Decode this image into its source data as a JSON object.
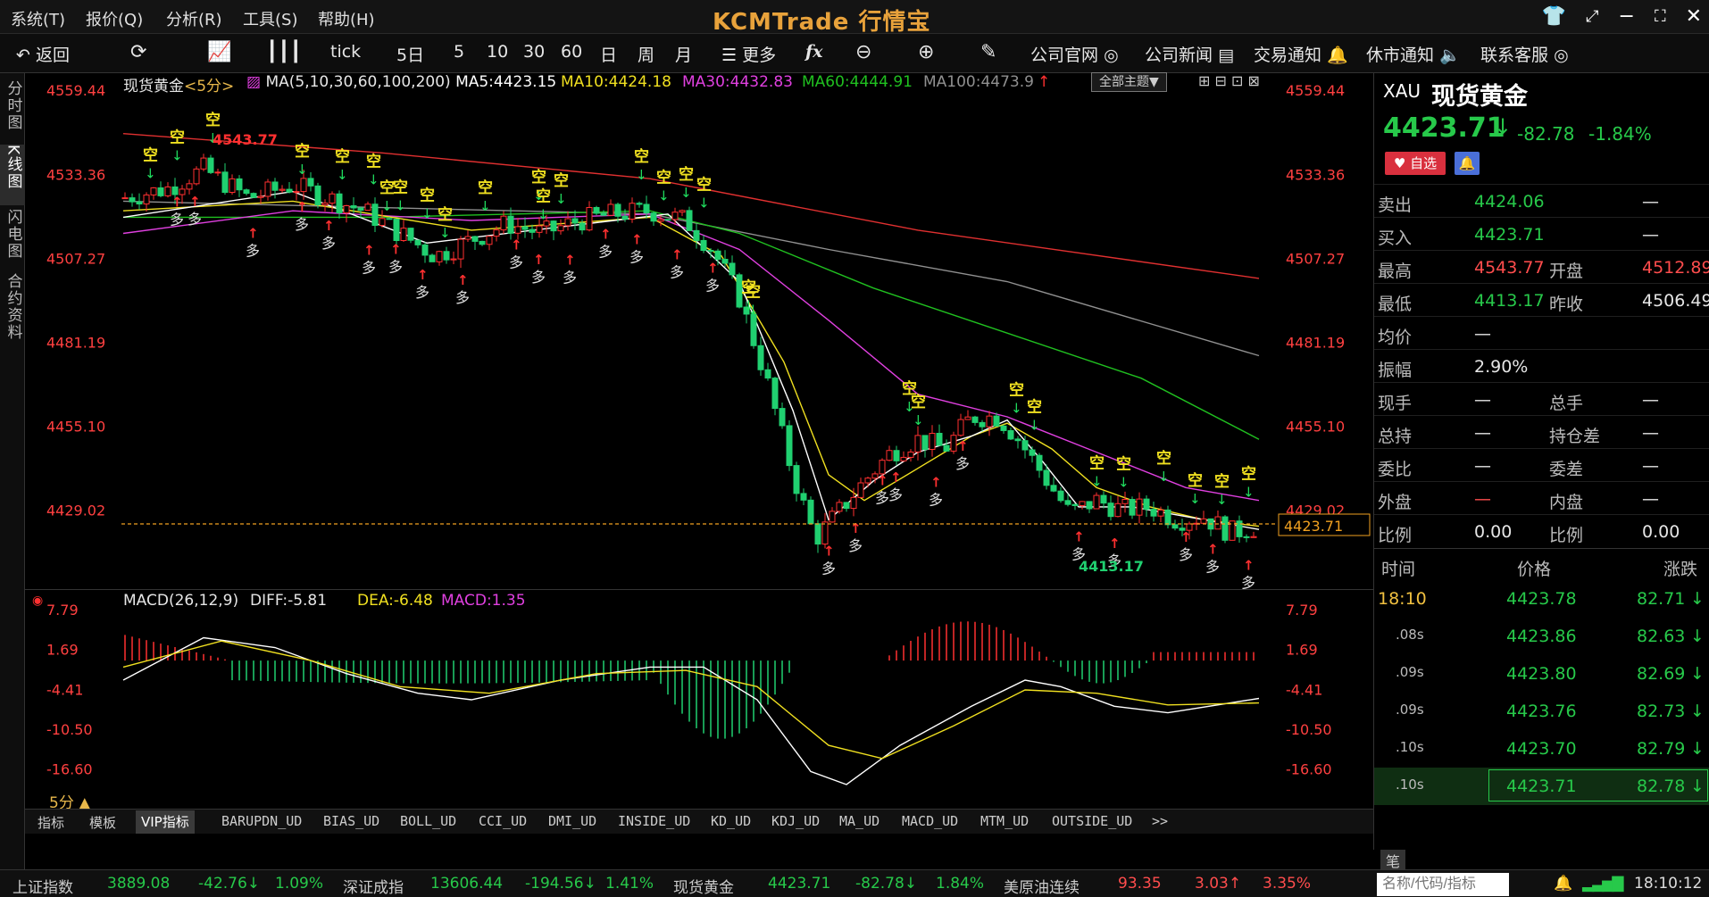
{
  "app": {
    "brand": "KCMTrade 行情宝",
    "menus": [
      "系统(T)",
      "报价(Q)",
      "分析(R)",
      "工具(S)",
      "帮助(H)"
    ],
    "window_controls": [
      "shirt-icon",
      "restore-icon",
      "minimize-icon",
      "maximize-icon",
      "close-icon"
    ]
  },
  "toolbar": {
    "back": "返回",
    "refresh_icon": "refresh-icon",
    "chart_icons": [
      "trend-chart-icon",
      "candlestick-icon"
    ],
    "periods": [
      "tick",
      "5日",
      "5",
      "10",
      "30",
      "60",
      "日",
      "周",
      "月"
    ],
    "more": "更多",
    "formula": "fx",
    "zoom_out_icon": "zoom-out-icon",
    "zoom_in_icon": "zoom-in-icon",
    "draw_icon": "pen-icon",
    "links": [
      "公司官网",
      "公司新闻",
      "交易通知",
      "休市通知",
      "联系客服"
    ]
  },
  "left_tabs": [
    "分时图",
    "K线图",
    "闪电图",
    "合约资料"
  ],
  "main_chart": {
    "instrument": "现货黄金",
    "period": "<5分>",
    "ma_params": "MA(5,10,30,60,100,200)",
    "ma5": "MA5:4423.15",
    "ma10": "MA10:4424.18",
    "ma30": "MA30:4432.83",
    "ma60": "MA60:4444.91",
    "ma100": "MA100:4473.9",
    "theme_select": "全部主题▼",
    "y_ticks": [
      "4559.44",
      "4533.36",
      "4507.27",
      "4481.19",
      "4455.10",
      "4429.02"
    ],
    "current_price_tag": "4423.71",
    "high_label": "4543.77",
    "low_label": "4413.17",
    "signal_short": "空",
    "signal_long": "多",
    "colors": {
      "ma5": "#ffffff",
      "ma10": "#f0e020",
      "ma30": "#e040e0",
      "ma60": "#20c020",
      "ma100": "#909090",
      "ma200": "#e03030",
      "up": "#ff3030",
      "down": "#20d070"
    }
  },
  "macd": {
    "label": "MACD(26,12,9)",
    "diff": "DIFF:-5.81",
    "dea": "DEA:-6.48",
    "macd": "MACD:1.35",
    "y_ticks": [
      "7.79",
      "1.69",
      "-4.41",
      "-10.50",
      "-16.60"
    ]
  },
  "period_label": "5分 ▲",
  "indicator_tabs": [
    "指标",
    "模板",
    "VIP指标",
    "BARUPDN_UD",
    "BIAS_UD",
    "BOLL_UD",
    "CCI_UD",
    "DMI_UD",
    "INSIDE_UD",
    "KD_UD",
    "KDJ_UD",
    "MA_UD",
    "MACD_UD",
    "MTM_UD",
    "OUTSIDE_UD",
    ">>"
  ],
  "quote": {
    "code": "XAU",
    "name": "现货黄金",
    "price": "4423.71",
    "change": "-82.78",
    "change_pct": "-1.84%",
    "fav_label": "自选",
    "rows": [
      {
        "l1": "卖出",
        "v1": "4424.06",
        "l2": "",
        "v2": "—"
      },
      {
        "l1": "买入",
        "v1": "4423.71",
        "l2": "",
        "v2": "—"
      },
      {
        "l1": "最高",
        "v1": "4543.77",
        "l2": "开盘",
        "v2": "4512.89"
      },
      {
        "l1": "最低",
        "v1": "4413.17",
        "l2": "昨收",
        "v2": "4506.49"
      },
      {
        "l1": "均价",
        "v1": "—",
        "l2": "",
        "v2": ""
      },
      {
        "l1": "振幅",
        "v1": "2.90%",
        "l2": "",
        "v2": ""
      },
      {
        "l1": "现手",
        "v1": "—",
        "l2": "总手",
        "v2": "—"
      },
      {
        "l1": "总持",
        "v1": "—",
        "l2": "持仓差",
        "v2": "—"
      },
      {
        "l1": "委比",
        "v1": "—",
        "l2": "委差",
        "v2": "—"
      },
      {
        "l1": "外盘",
        "v1": "—",
        "l2": "内盘",
        "v2": "—"
      },
      {
        "l1": "比例",
        "v1": "0.00",
        "l2": "比例",
        "v2": "0.00"
      }
    ],
    "tick_header": {
      "time": "时间",
      "price": "价格",
      "change": "涨跌"
    },
    "ticks": [
      {
        "time": "18:10",
        "price": "4423.78",
        "change": "82.71"
      },
      {
        "time": ".08s",
        "price": "4423.86",
        "change": "82.63"
      },
      {
        "time": ".09s",
        "price": "4423.80",
        "change": "82.69"
      },
      {
        "time": ".09s",
        "price": "4423.76",
        "change": "82.73"
      },
      {
        "time": ".10s",
        "price": "4423.70",
        "change": "82.79"
      },
      {
        "time": ".10s",
        "price": "4423.71",
        "change": "82.78"
      }
    ],
    "bottom_label": "笔"
  },
  "statusbar": {
    "items": [
      {
        "name": "上证指数",
        "value": "3889.08",
        "change": "-42.76↓",
        "pct": "1.09%"
      },
      {
        "name": "深证成指",
        "value": "13606.44",
        "change": "-194.56↓",
        "pct": "1.41%"
      },
      {
        "name": "现货黄金",
        "value": "4423.71",
        "change": "-82.78↓",
        "pct": "1.84%"
      },
      {
        "name": "美原油连续",
        "value": "93.35",
        "change": "3.03↑",
        "pct": "3.35%"
      }
    ],
    "search_placeholder": "名称/代码/指标",
    "clock": "18:10:12"
  }
}
